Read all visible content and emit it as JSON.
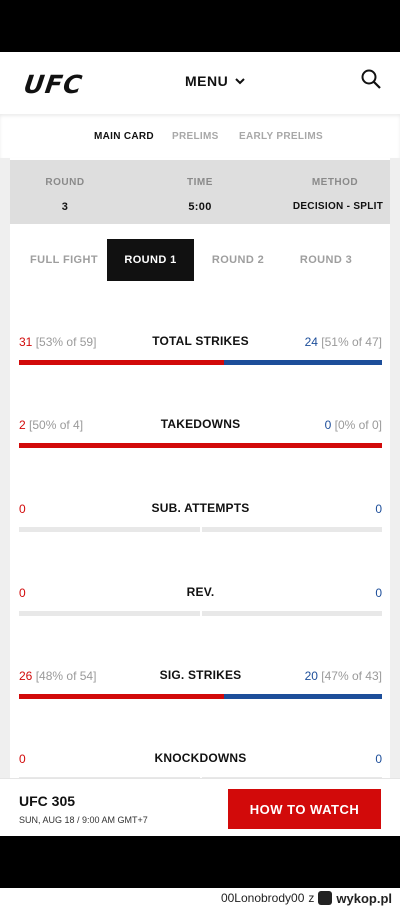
{
  "header": {
    "logo": "UFC",
    "menu_label": "MENU"
  },
  "subnav": {
    "items": [
      "MAIN CARD",
      "PRELIMS",
      "EARLY PRELIMS"
    ]
  },
  "fight_info": {
    "round_label": "ROUND",
    "round_value": "3",
    "time_label": "TIME",
    "time_value": "5:00",
    "method_label": "METHOD",
    "method_value": "DECISION - SPLIT"
  },
  "round_tabs": [
    "FULL FIGHT",
    "ROUND 1",
    "ROUND 2",
    "ROUND 3"
  ],
  "stats": [
    {
      "name": "TOTAL STRIKES",
      "left": "31",
      "left_pct": "[53% of 59]",
      "right": "24",
      "right_pct": "[51% of 47]",
      "left_share": 0.564
    },
    {
      "name": "TAKEDOWNS",
      "left": "2",
      "left_pct": "[50% of 4]",
      "right": "0",
      "right_pct": "[0% of 0]",
      "left_share": 1.0
    },
    {
      "name": "SUB. ATTEMPTS",
      "left": "0",
      "left_pct": "",
      "right": "0",
      "right_pct": "",
      "left_share": null
    },
    {
      "name": "REV.",
      "left": "0",
      "left_pct": "",
      "right": "0",
      "right_pct": "",
      "left_share": null
    },
    {
      "name": "SIG. STRIKES",
      "left": "26",
      "left_pct": "[48% of 54]",
      "right": "20",
      "right_pct": "[47% of 43]",
      "left_share": 0.565
    },
    {
      "name": "KNOCKDOWNS",
      "left": "0",
      "left_pct": "",
      "right": "0",
      "right_pct": "",
      "left_share": null
    }
  ],
  "footer": {
    "event": "UFC 305",
    "date": "SUN, AUG 18 / 9:00 AM GMT+7",
    "cta": "HOW TO WATCH"
  },
  "credit": {
    "user": "00Lonobrody00",
    "via": "z",
    "site": "wykop.pl"
  },
  "colors": {
    "red": "#d20a0a",
    "blue": "#1d4e9a"
  }
}
